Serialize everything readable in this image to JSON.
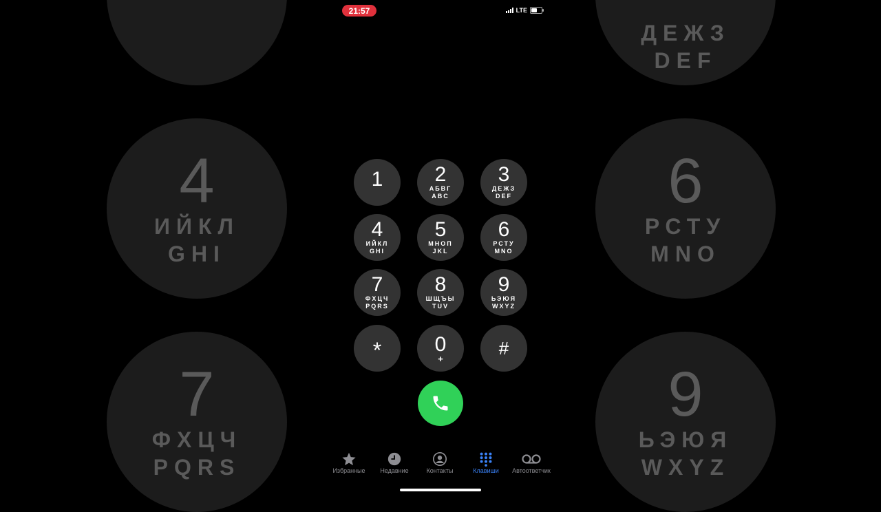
{
  "status": {
    "time": "21:57",
    "network": "LTE"
  },
  "keys": [
    {
      "digit": "1",
      "l1": "",
      "l2": ""
    },
    {
      "digit": "2",
      "l1": "АБВГ",
      "l2": "ABC"
    },
    {
      "digit": "3",
      "l1": "ДЕЖЗ",
      "l2": "DEF"
    },
    {
      "digit": "4",
      "l1": "ИЙКЛ",
      "l2": "GHI"
    },
    {
      "digit": "5",
      "l1": "МНОП",
      "l2": "JKL"
    },
    {
      "digit": "6",
      "l1": "РСТУ",
      "l2": "MNO"
    },
    {
      "digit": "7",
      "l1": "ФХЦЧ",
      "l2": "PQRS"
    },
    {
      "digit": "8",
      "l1": "ШЩЪЫ",
      "l2": "TUV"
    },
    {
      "digit": "9",
      "l1": "ЬЭЮЯ",
      "l2": "WXYZ"
    },
    {
      "digit": "*"
    },
    {
      "digit": "0",
      "sub": "+"
    },
    {
      "digit": "#"
    }
  ],
  "tabs": [
    {
      "label": "Избранные",
      "icon": "star-icon"
    },
    {
      "label": "Недавние",
      "icon": "clock-icon"
    },
    {
      "label": "Контакты",
      "icon": "person-circle-icon"
    },
    {
      "label": "Клавиши",
      "icon": "keypad-icon"
    },
    {
      "label": "Автоответчик",
      "icon": "voicemail-icon"
    }
  ],
  "active_tab": "Клавиши",
  "colors": {
    "accent": "#3a82f7",
    "call": "#30d158",
    "key_bg": "#333333",
    "time_pill": "#e0313c"
  }
}
